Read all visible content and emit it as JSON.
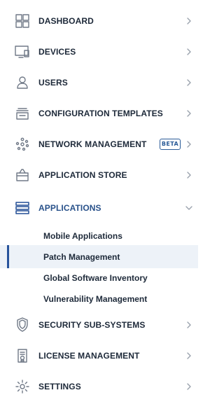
{
  "sidebar": {
    "items": [
      {
        "label": "DASHBOARD",
        "icon": "dashboard-icon",
        "expanded": false
      },
      {
        "label": "DEVICES",
        "icon": "devices-icon",
        "expanded": false
      },
      {
        "label": "USERS",
        "icon": "users-icon",
        "expanded": false
      },
      {
        "label": "CONFIGURATION TEMPLATES",
        "icon": "configuration-templates-icon",
        "expanded": false
      },
      {
        "label": "NETWORK MANAGEMENT",
        "badge": "BETA",
        "icon": "network-management-icon",
        "expanded": false
      },
      {
        "label": "APPLICATION STORE",
        "icon": "application-store-icon",
        "expanded": false
      },
      {
        "label": "APPLICATIONS",
        "icon": "applications-icon",
        "expanded": true,
        "children": [
          {
            "label": "Mobile Applications"
          },
          {
            "label": "Patch Management",
            "selected": true
          },
          {
            "label": "Global Software Inventory"
          },
          {
            "label": "Vulnerability Management"
          }
        ]
      },
      {
        "label": "SECURITY SUB-SYSTEMS",
        "icon": "security-sub-systems-icon",
        "expanded": false
      },
      {
        "label": "LICENSE MANAGEMENT",
        "icon": "license-management-icon",
        "expanded": false
      },
      {
        "label": "SETTINGS",
        "icon": "settings-icon",
        "expanded": false
      }
    ]
  },
  "colors": {
    "text": "#1d2939",
    "icon": "#707987",
    "active": "#234f95",
    "selected_background": "#edf2f8",
    "selected_bar": "#27539b",
    "chevron": "#9aa2ad"
  }
}
